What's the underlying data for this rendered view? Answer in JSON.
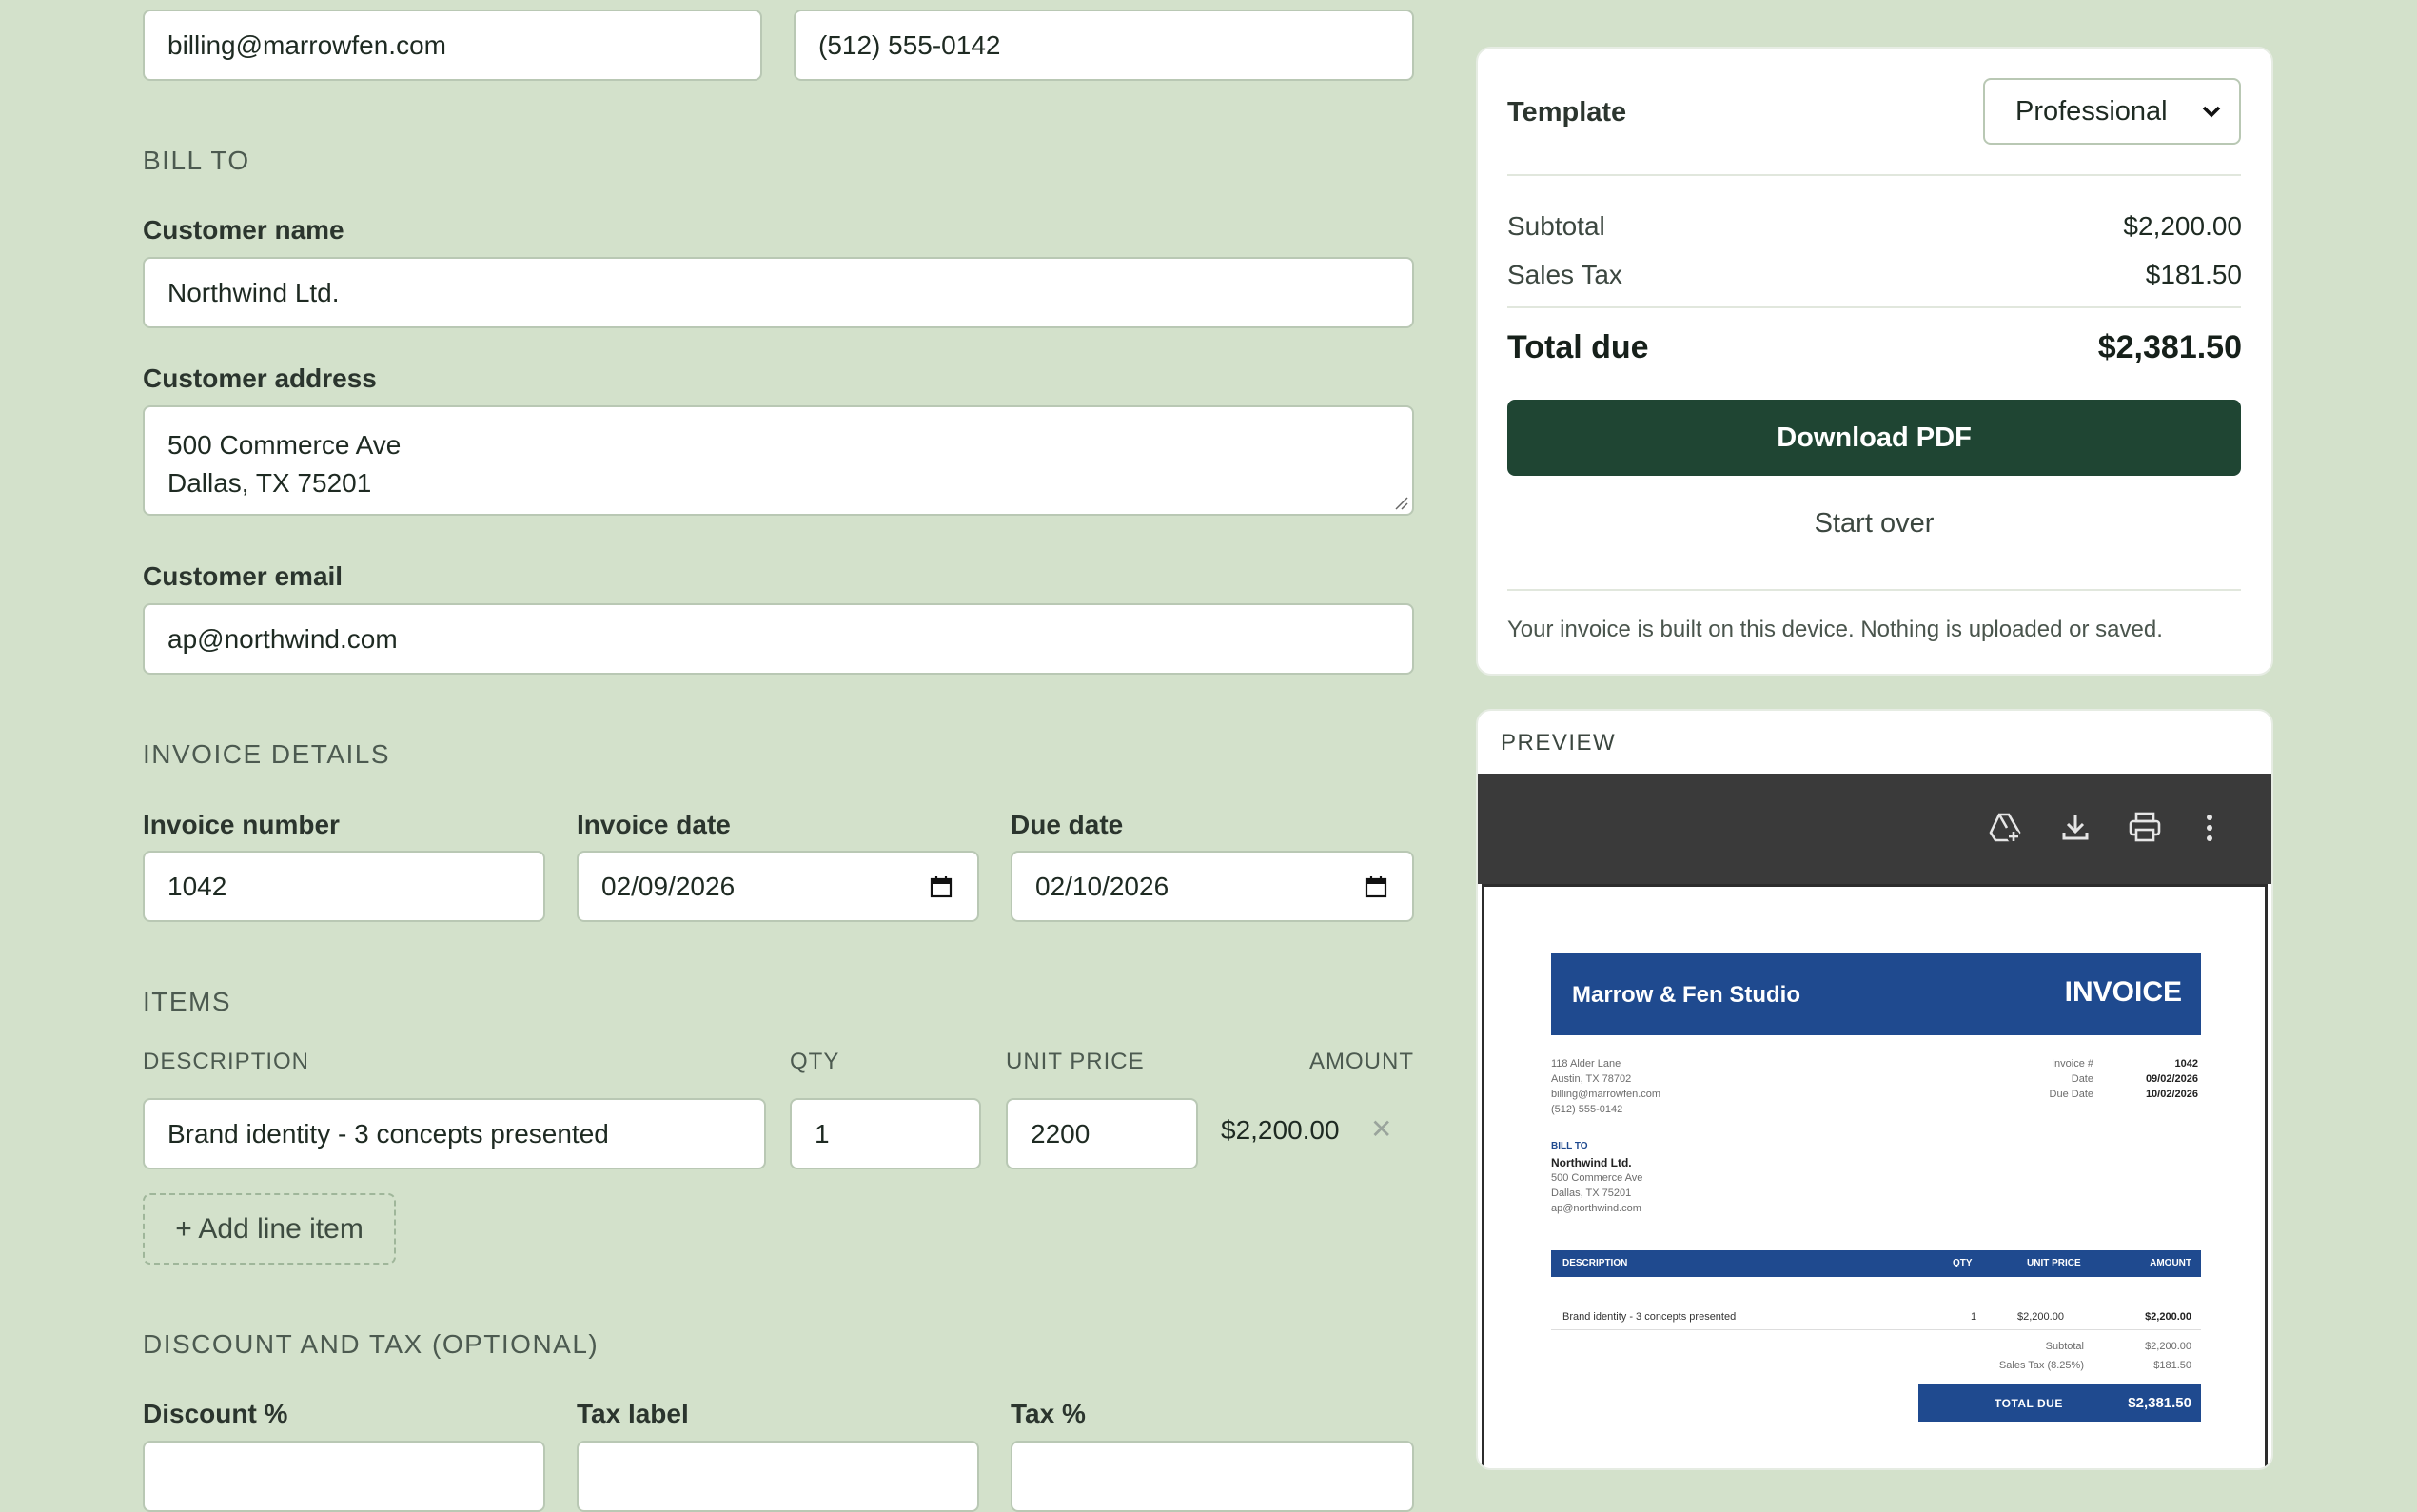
{
  "from": {
    "email": "billing@marrowfen.com",
    "phone": "(512) 555-0142"
  },
  "bill_to": {
    "section": "BILL TO",
    "name_label": "Customer name",
    "name_value": "Northwind Ltd.",
    "address_label": "Customer address",
    "address_value": "500 Commerce Ave\nDallas, TX 75201",
    "email_label": "Customer email",
    "email_value": "ap@northwind.com"
  },
  "invoice_details": {
    "section": "INVOICE DETAILS",
    "number_label": "Invoice number",
    "number_value": "1042",
    "date_label": "Invoice date",
    "date_value": "02/09/2026",
    "due_label": "Due date",
    "due_value": "02/10/2026"
  },
  "items": {
    "section": "ITEMS",
    "columns": [
      "DESCRIPTION",
      "QTY",
      "UNIT PRICE",
      "AMOUNT"
    ],
    "rows": [
      {
        "description": "Brand identity - 3 concepts presented",
        "qty": "1",
        "unit_price": "2200",
        "amount": "$2,200.00"
      }
    ],
    "add_label": "+ Add line item",
    "remove_glyph": "✕"
  },
  "discount_tax": {
    "section": "DISCOUNT AND TAX (OPTIONAL)",
    "discount_label": "Discount %",
    "tax_label_label": "Tax label",
    "tax_pct_label": "Tax %"
  },
  "summary": {
    "template_label": "Template",
    "template_value": "Professional",
    "subtotal_label": "Subtotal",
    "subtotal_value": "$2,200.00",
    "tax_label": "Sales Tax",
    "tax_value": "$181.50",
    "total_label": "Total due",
    "total_value": "$2,381.50",
    "download_label": "Download PDF",
    "start_over_label": "Start over",
    "note": "Your invoice is built on this device. Nothing is uploaded or saved."
  },
  "preview": {
    "header": "PREVIEW",
    "doc": {
      "company": "Marrow & Fen Studio",
      "title": "INVOICE",
      "from_lines": "118 Alder Lane\nAustin, TX 78702\nbilling@marrowfen.com\n(512) 555-0142",
      "meta_labels": "Invoice #\nDate\nDue Date",
      "meta_values": [
        "1042",
        "09/02/2026",
        "10/02/2026"
      ],
      "bill_to_label": "BILL TO",
      "bill_to_name": "Northwind Ltd.",
      "bill_to_lines": "500 Commerce Ave\nDallas, TX 75201\nap@northwind.com",
      "table_head": [
        "DESCRIPTION",
        "QTY",
        "UNIT PRICE",
        "AMOUNT"
      ],
      "row": {
        "description": "Brand identity - 3 concepts presented",
        "qty": "1",
        "unit_price": "$2,200.00",
        "amount": "$2,200.00"
      },
      "subtotal_label": "Subtotal",
      "subtotal_value": "$2,200.00",
      "tax_label": "Sales Tax (8.25%)",
      "tax_value": "$181.50",
      "total_label": "TOTAL DUE",
      "total_value": "$2,381.50"
    }
  },
  "colors": {
    "background": "#d3e1cb",
    "primary_button": "#1f4533",
    "invoice_blue": "#1f4a8f",
    "viewer_toolbar": "#3a3a3a"
  }
}
